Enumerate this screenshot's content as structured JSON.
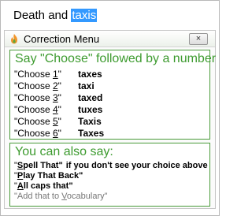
{
  "document": {
    "text_before": "Death and ",
    "text_selected": "taxis"
  },
  "dialog": {
    "title": "Correction Menu",
    "close_label": "×"
  },
  "choices_panel": {
    "heading": "Say \"Choose\" followed by a number",
    "choices": [
      {
        "pre": "\"Choose ",
        "num": "1",
        "post": "\"",
        "word": "taxes"
      },
      {
        "pre": "\"Choose ",
        "num": "2",
        "post": "\"",
        "word": "taxi"
      },
      {
        "pre": "\"Choose ",
        "num": "3",
        "post": "\"",
        "word": "taxed"
      },
      {
        "pre": "\"Choose ",
        "num": "4",
        "post": "\"",
        "word": "tuxes"
      },
      {
        "pre": "\"Choose ",
        "num": "5",
        "post": "\"",
        "word": "Taxis"
      },
      {
        "pre": "\"Choose ",
        "num": "6",
        "post": "\"",
        "word": "Taxes"
      }
    ]
  },
  "tips_panel": {
    "heading": "You can also say:",
    "tips": [
      {
        "open": "\"",
        "key": "S",
        "rest": "pell That\"",
        "hint": "if you don't see your choice above"
      },
      {
        "open": "\"",
        "key": "P",
        "rest": "lay That Back\"",
        "hint": ""
      },
      {
        "open": "\"",
        "key": "A",
        "rest": "ll caps that\"",
        "hint": ""
      }
    ],
    "vocab_tip": {
      "pre": "\"Add that to ",
      "key": "V",
      "rest": "ocabulary\""
    }
  },
  "colors": {
    "accent_green": "#3d9b2f",
    "panel_border": "#4a9b3a",
    "selection": "#3399ff",
    "muted_text": "#777777"
  },
  "icons": {
    "title_icon": "flame-icon",
    "close_icon": "close-icon"
  }
}
